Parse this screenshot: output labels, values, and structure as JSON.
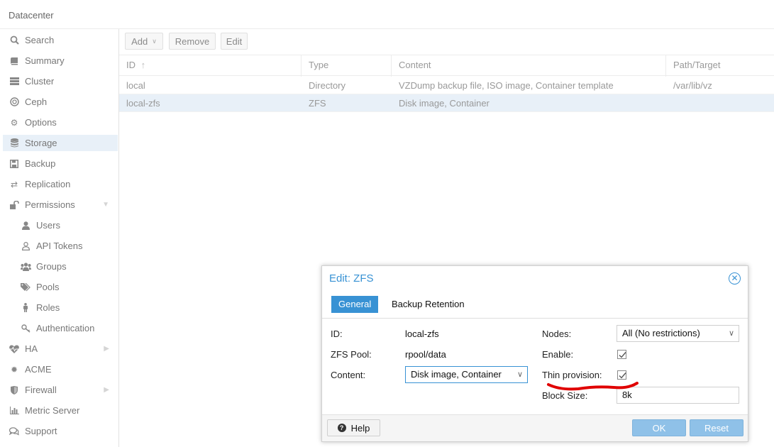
{
  "topbar": {
    "title": "Datacenter"
  },
  "sidebar": {
    "items": [
      {
        "label": "Search",
        "icon": "search-icon"
      },
      {
        "label": "Summary",
        "icon": "book-icon"
      },
      {
        "label": "Cluster",
        "icon": "server-icon"
      },
      {
        "label": "Ceph",
        "icon": "ceph-icon"
      },
      {
        "label": "Options",
        "icon": "gear-icon"
      },
      {
        "label": "Storage",
        "icon": "database-icon",
        "selected": true
      },
      {
        "label": "Backup",
        "icon": "floppy-icon"
      },
      {
        "label": "Replication",
        "icon": "retweet-icon"
      },
      {
        "label": "Permissions",
        "icon": "unlock-icon"
      },
      {
        "label": "Users",
        "icon": "user-icon"
      },
      {
        "label": "API Tokens",
        "icon": "user-outline-icon"
      },
      {
        "label": "Groups",
        "icon": "users-icon"
      },
      {
        "label": "Pools",
        "icon": "tags-icon"
      },
      {
        "label": "Roles",
        "icon": "male-icon"
      },
      {
        "label": "Authentication",
        "icon": "key-icon"
      },
      {
        "label": "HA",
        "icon": "heartbeat-icon"
      },
      {
        "label": "ACME",
        "icon": "certificate-icon"
      },
      {
        "label": "Firewall",
        "icon": "shield-icon"
      },
      {
        "label": "Metric Server",
        "icon": "bar-chart-icon"
      },
      {
        "label": "Support",
        "icon": "comments-icon"
      }
    ]
  },
  "toolbar": {
    "add_label": "Add",
    "remove_label": "Remove",
    "edit_label": "Edit"
  },
  "grid": {
    "columns": [
      "ID",
      "Type",
      "Content",
      "Path/Target"
    ],
    "sort_indicator": "↑",
    "rows": [
      {
        "id": "local",
        "type": "Directory",
        "content": "VZDump backup file, ISO image, Container template",
        "path": "/var/lib/vz"
      },
      {
        "id": "local-zfs",
        "type": "ZFS",
        "content": "Disk image, Container",
        "path": ""
      }
    ]
  },
  "dialog": {
    "title": "Edit: ZFS",
    "tabs": [
      "General",
      "Backup Retention"
    ],
    "id_label": "ID:",
    "id_value": "local-zfs",
    "pool_label": "ZFS Pool:",
    "pool_value": "rpool/data",
    "content_label": "Content:",
    "content_value": "Disk image, Container",
    "nodes_label": "Nodes:",
    "nodes_value": "All (No restrictions)",
    "enable_label": "Enable:",
    "enable_checked": true,
    "thin_label": "Thin provision:",
    "thin_checked": true,
    "block_label": "Block Size:",
    "block_value": "8k",
    "help_label": "Help",
    "ok_label": "OK",
    "reset_label": "Reset"
  },
  "colors": {
    "accent": "#3892d4",
    "selection": "#e8f0f8",
    "annotation": "#e00000"
  }
}
